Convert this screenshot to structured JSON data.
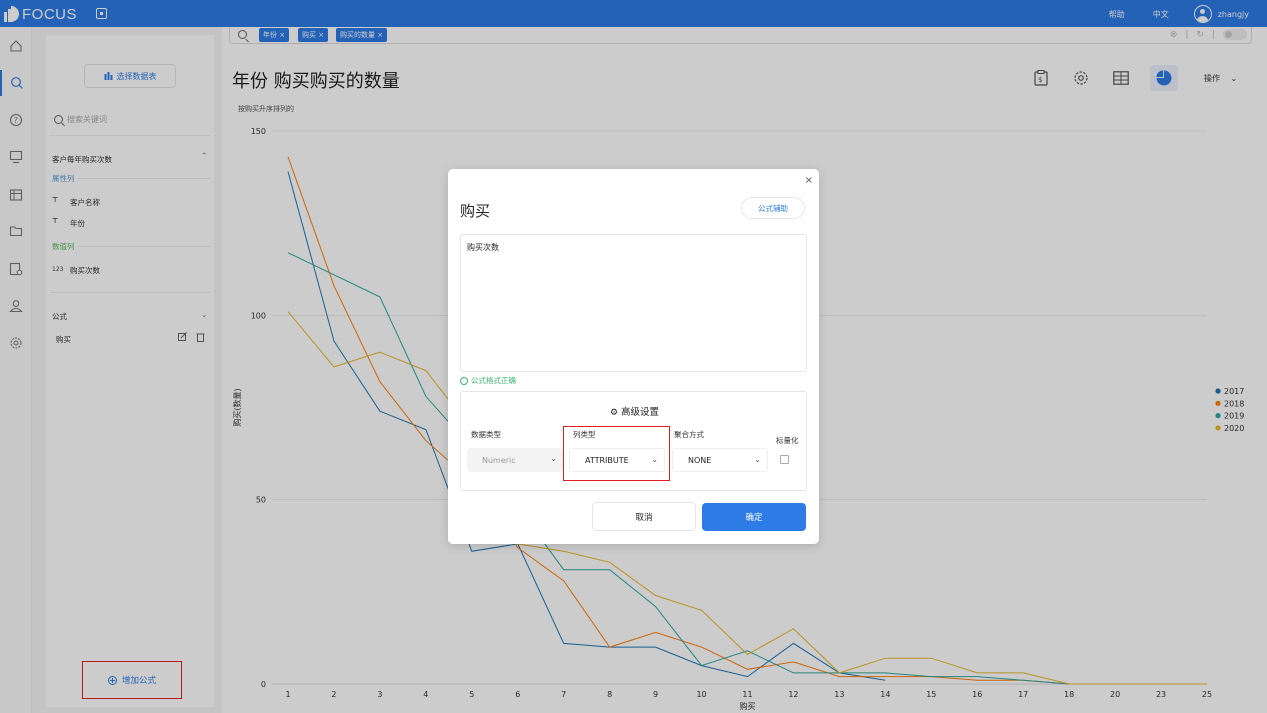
{
  "app": {
    "brand": "FOCUS",
    "help": "帮助",
    "language": "中文",
    "username": "zhangjy"
  },
  "rail": {
    "icons": [
      "home-icon",
      "search-icon",
      "help-icon",
      "dashboard-icon",
      "table-icon",
      "folder-icon",
      "settings-data-icon",
      "user-icon",
      "gear-icon"
    ]
  },
  "sidebar": {
    "choose_table": "选择数据表",
    "search_placeholder": "搜索关键词",
    "table_name": "客户每年购买次数",
    "attr_group": "属性列",
    "attr_items": [
      {
        "type": "T",
        "label": "客户名称"
      },
      {
        "type": "T",
        "label": "年份"
      }
    ],
    "num_group": "数值列",
    "num_items": [
      {
        "type": "123",
        "label": "购买次数"
      }
    ],
    "formula_group": "公式",
    "formula_items": [
      {
        "label": "购买"
      }
    ],
    "add_formula": "增加公式"
  },
  "search": {
    "chips": [
      "年份 ×",
      "购买 ×",
      "购买的数量 ×"
    ]
  },
  "page": {
    "title": "年份 购买购买的数量",
    "subtitle": "按购买升序排列的",
    "ops_label": "操作"
  },
  "chart_data": {
    "type": "line",
    "xlabel": "购买",
    "ylabel": "购买(数量)",
    "ylim": [
      0,
      150
    ],
    "yticks": [
      0,
      50,
      100,
      150
    ],
    "categories": [
      "1",
      "2",
      "3",
      "4",
      "5",
      "6",
      "7",
      "8",
      "9",
      "10",
      "11",
      "12",
      "13",
      "14",
      "15",
      "16",
      "17",
      "18",
      "20",
      "23",
      "25"
    ],
    "series": [
      {
        "name": "2017",
        "color": "#1f77b4",
        "values": [
          139,
          93,
          74,
          69,
          36,
          38,
          11,
          10,
          10,
          5,
          2,
          11,
          3,
          1,
          null,
          null,
          null,
          null,
          null,
          null,
          null
        ]
      },
      {
        "name": "2018",
        "color": "#ff7f0e",
        "values": [
          143,
          108,
          82,
          66,
          55,
          37,
          28,
          10,
          14,
          10,
          4,
          6,
          2,
          2,
          2,
          1,
          1,
          0,
          0,
          0,
          0
        ]
      },
      {
        "name": "2019",
        "color": "#2ca8a0",
        "values": [
          117,
          111,
          105,
          78,
          64,
          48,
          31,
          31,
          21,
          5,
          9,
          3,
          3,
          3,
          2,
          2,
          1,
          0,
          0,
          0,
          0
        ]
      },
      {
        "name": "2020",
        "color": "#e8b82a",
        "values": [
          101,
          86,
          90,
          85,
          69,
          38,
          36,
          33,
          24,
          20,
          8,
          15,
          3,
          7,
          7,
          3,
          3,
          0,
          0,
          0,
          0
        ]
      }
    ],
    "legend": "right",
    "grid": true
  },
  "modal": {
    "title": "购买",
    "close": "×",
    "formula_help": "公式辅助",
    "formula": "购买次数",
    "formula_valid": "公式格式正确",
    "advanced_title": "高级设置",
    "data_type_label": "数据类型",
    "data_type_value": "Numeric",
    "column_type_label": "列类型",
    "column_type_value": "ATTRIBUTE",
    "aggregation_label": "聚合方式",
    "aggregation_value": "NONE",
    "normalize_label": "标量化",
    "cancel": "取消",
    "confirm": "确定"
  }
}
